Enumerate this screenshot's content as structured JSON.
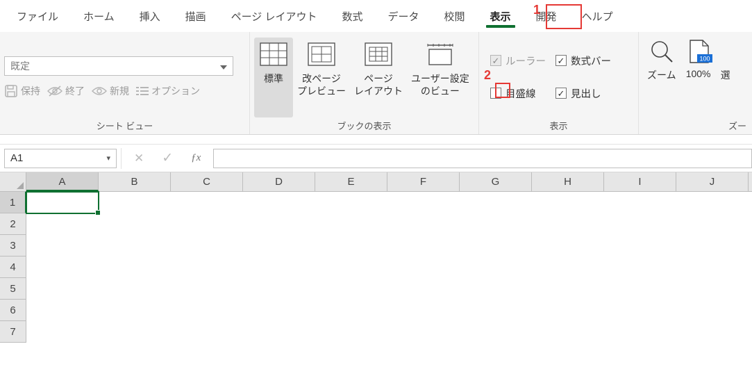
{
  "tabs": {
    "file": "ファイル",
    "home": "ホーム",
    "insert": "挿入",
    "draw": "描画",
    "page_layout": "ページ レイアウト",
    "formulas": "数式",
    "data": "データ",
    "review": "校閲",
    "view": "表示",
    "developer": "開発",
    "help": "ヘルプ"
  },
  "annotations": {
    "a1": "1",
    "a2": "2"
  },
  "ribbon": {
    "sheet_view": {
      "select_value": "既定",
      "keep": "保持",
      "quit": "終了",
      "new": "新規",
      "options": "オプション",
      "group_label": "シート ビュー"
    },
    "workbook_views": {
      "normal": "標準",
      "page_break": "改ページ\nプレビュー",
      "page_layout": "ページ\nレイアウト",
      "custom": "ユーザー設定\nのビュー",
      "group_label": "ブックの表示"
    },
    "show": {
      "ruler": "ルーラー",
      "formula_bar": "数式バー",
      "gridlines": "目盛線",
      "headings": "見出し",
      "group_label": "表示"
    },
    "zoom": {
      "zoom": "ズーム",
      "hundred": "100%",
      "selection": "選",
      "group_label": "ズー"
    }
  },
  "formula_bar": {
    "name_box": "A1"
  },
  "sheet": {
    "columns": [
      "A",
      "B",
      "C",
      "D",
      "E",
      "F",
      "G",
      "H",
      "I",
      "J"
    ],
    "rows": [
      "1",
      "2",
      "3",
      "4",
      "5",
      "6",
      "7"
    ],
    "active": "A1"
  }
}
